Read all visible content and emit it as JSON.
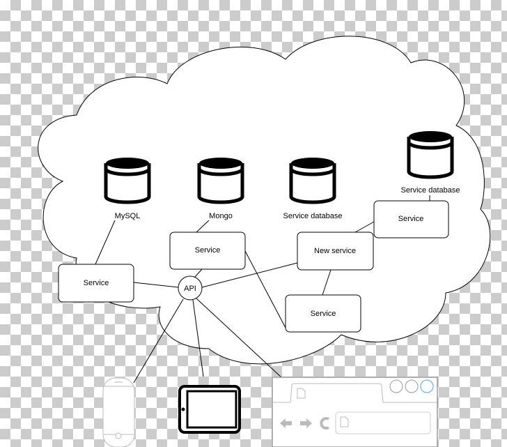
{
  "databases": [
    {
      "label": "MySQL"
    },
    {
      "label": "Mongo"
    },
    {
      "label": "Service database"
    },
    {
      "label": "Service database"
    }
  ],
  "services": [
    {
      "label": "Service"
    },
    {
      "label": "Service"
    },
    {
      "label": "New service"
    },
    {
      "label": "Service"
    },
    {
      "label": "Service"
    }
  ],
  "api": {
    "label": "API"
  },
  "colors": {
    "stroke": "#000000",
    "browser_gray": "#bbbbbb",
    "accent_circle": "#4aa8e0"
  },
  "clients": [
    "phone-icon",
    "tablet-icon",
    "browser-window-icon"
  ]
}
